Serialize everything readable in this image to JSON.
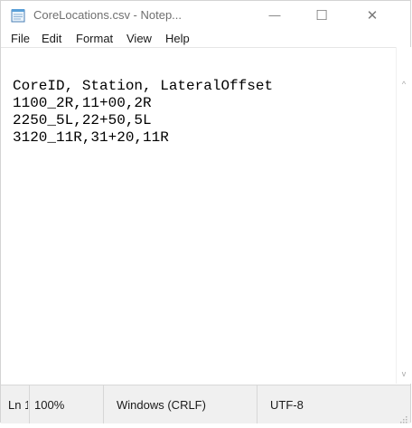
{
  "window": {
    "title": "CoreLocations.csv - Notep...",
    "icon": "notepad-icon",
    "minimize_glyph": "—",
    "maximize_glyph": "☐",
    "close_glyph": "✕"
  },
  "menu": {
    "items": [
      "File",
      "Edit",
      "Format",
      "View",
      "Help"
    ]
  },
  "editor": {
    "lines": [
      "CoreID, Station, LateralOffset",
      "1100_2R,11+00,2R",
      "2250_5L,22+50,5L",
      "3120_11R,31+20,11R"
    ]
  },
  "scrollbar": {
    "up_glyph": "^",
    "down_glyph": "v"
  },
  "statusbar": {
    "position": "Ln 1",
    "zoom": "100%",
    "line_ending": "Windows (CRLF)",
    "encoding": "UTF-8"
  }
}
